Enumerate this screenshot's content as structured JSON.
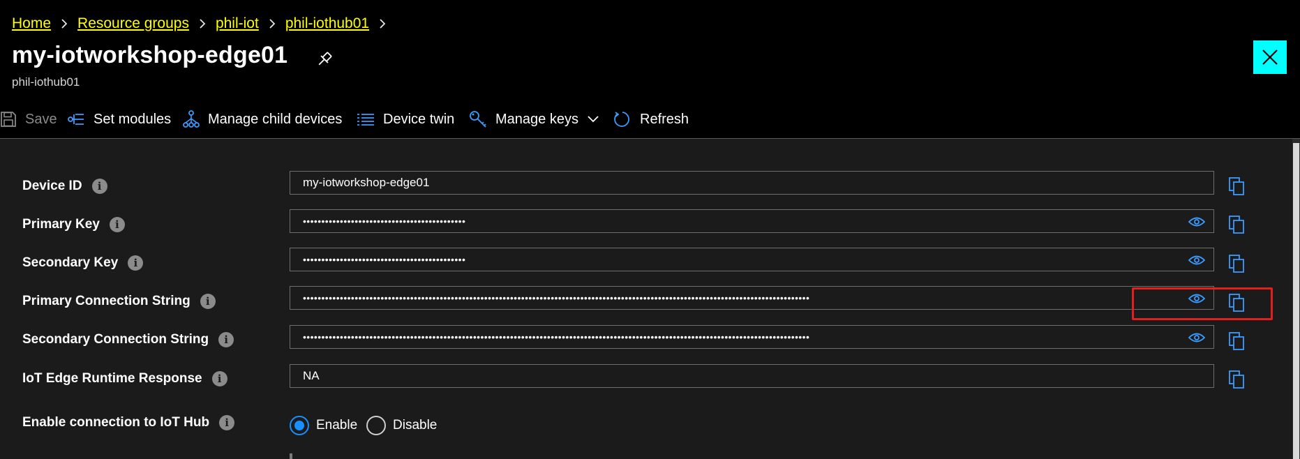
{
  "breadcrumb": {
    "items": [
      "Home",
      "Resource groups",
      "phil-iot",
      "phil-iothub01"
    ]
  },
  "header": {
    "title": "my-iotworkshop-edge01",
    "subtitle": "phil-iothub01",
    "close_icon": "close-icon",
    "pin_icon": "pin-icon"
  },
  "toolbar": {
    "save": "Save",
    "set_modules": "Set modules",
    "manage_child": "Manage child devices",
    "device_twin": "Device twin",
    "manage_keys": "Manage keys",
    "refresh": "Refresh"
  },
  "fields": {
    "device_id": {
      "label": "Device ID",
      "value": "my-iotworkshop-edge01"
    },
    "primary_key": {
      "label": "Primary Key",
      "value": "••••••••••••••••••••••••••••••••••••••••••••"
    },
    "secondary_key": {
      "label": "Secondary Key",
      "value": "••••••••••••••••••••••••••••••••••••••••••••"
    },
    "primary_conn": {
      "label": "Primary Connection String",
      "value": "•••••••••••••••••••••••••••••••••••••••••••••••••••••••••••••••••••••••••••••••••••••••••••••••••••••••••••••••••••••••••••••••••••••••••"
    },
    "secondary_conn": {
      "label": "Secondary Connection String",
      "value": "•••••••••••••••••••••••••••••••••••••••••••••••••••••••••••••••••••••••••••••••••••••••••••••••••••••••••••••••••••••••••••••••••••••••••"
    },
    "runtime_response": {
      "label": "IoT Edge Runtime Response",
      "value": "NA"
    }
  },
  "connection": {
    "label": "Enable connection to IoT Hub",
    "enable": "Enable",
    "disable": "Disable",
    "selected": "Enable"
  },
  "colors": {
    "link": "#ffff00",
    "accent": "#1890ff",
    "close_bg": "#00ffff",
    "highlight": "#e01f1f"
  }
}
